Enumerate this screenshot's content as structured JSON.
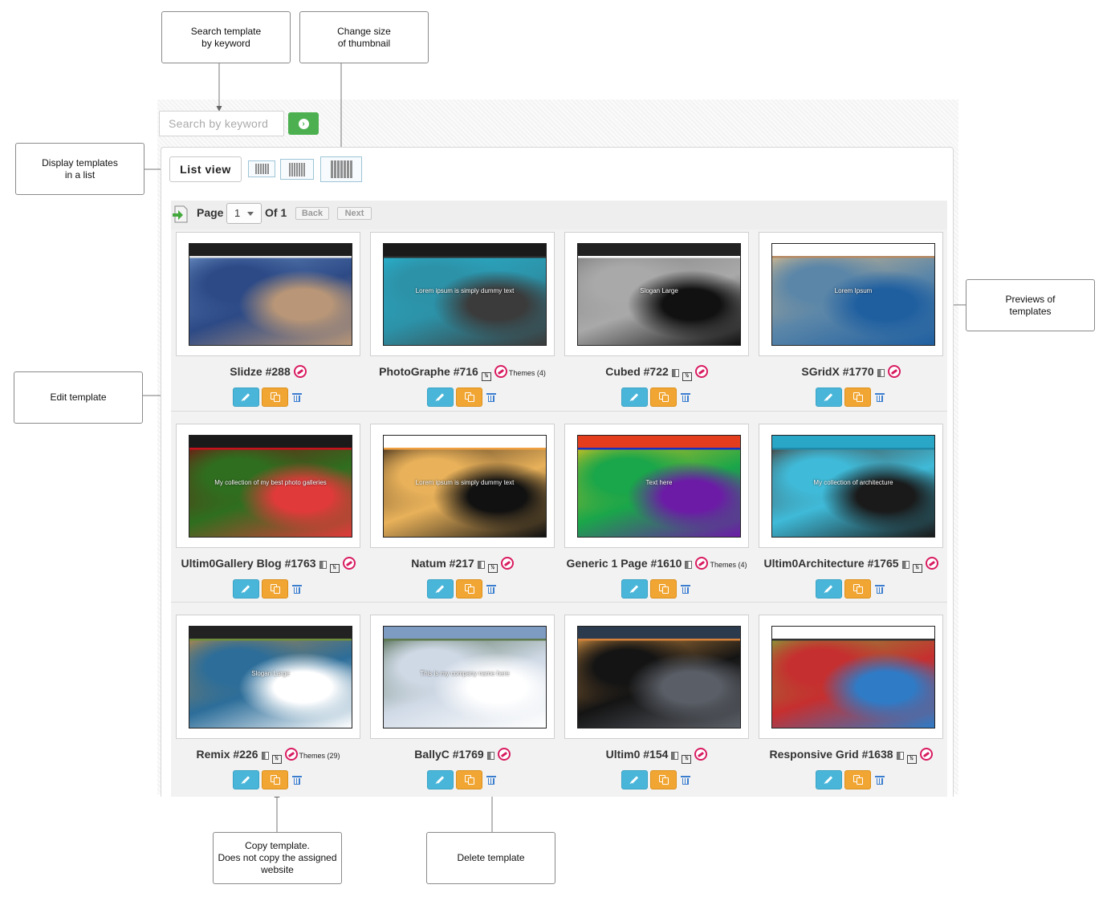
{
  "annotations": {
    "search": "Search template\nby keyword",
    "resize": "Change size\nof thumbnail",
    "list": "Display templates\nin a list",
    "previews": "Previews of\ntemplates",
    "edit": "Edit template",
    "copy": "Copy template.\nDoes not copy the assigned\nwebsite",
    "delete": "Delete template"
  },
  "search": {
    "placeholder": "Search by keyword"
  },
  "toolbar": {
    "list_view_label": "List view"
  },
  "pagination": {
    "page_label": "Page",
    "current_page": "1",
    "of_label": "Of 1",
    "back_label": "Back",
    "next_label": "Next"
  },
  "colors": {
    "edit": "#49b6d9",
    "copy": "#f1a532",
    "delete": "#3b7ed0",
    "go": "#4cb050",
    "badge": "#d81b60"
  },
  "templates": [
    {
      "name": "Slidze #288",
      "icons": [
        "theme-badge-icon"
      ],
      "themes": ""
    },
    {
      "name": "PhotoGraphe #716",
      "icons": [
        "half-size-icon",
        "theme-badge-icon"
      ],
      "themes": "Themes (4)"
    },
    {
      "name": "Cubed #722",
      "icons": [
        "layout-icon",
        "half-size-icon",
        "theme-badge-icon"
      ],
      "themes": ""
    },
    {
      "name": "SGridX #1770",
      "icons": [
        "layout-icon",
        "theme-badge-icon"
      ],
      "themes": ""
    },
    {
      "name": "Ultim0Gallery Blog #1763",
      "icons": [
        "layout-icon",
        "half-size-icon",
        "theme-badge-icon"
      ],
      "themes": ""
    },
    {
      "name": "Natum #217",
      "icons": [
        "layout-icon",
        "half-size-icon",
        "theme-badge-icon"
      ],
      "themes": ""
    },
    {
      "name": "Generic 1 Page #1610",
      "icons": [
        "layout-icon",
        "theme-badge-icon"
      ],
      "themes": "Themes (4)"
    },
    {
      "name": "Ultim0Architecture #1765",
      "icons": [
        "layout-icon",
        "half-size-icon",
        "theme-badge-icon"
      ],
      "themes": ""
    },
    {
      "name": "Remix #226",
      "icons": [
        "layout-icon",
        "half-size-icon",
        "theme-badge-icon"
      ],
      "themes": "Themes (29)"
    },
    {
      "name": "BallyC #1769",
      "icons": [
        "layout-icon",
        "theme-badge-icon"
      ],
      "themes": ""
    },
    {
      "name": "Ultim0 #154",
      "icons": [
        "layout-icon",
        "half-size-icon",
        "theme-badge-icon"
      ],
      "themes": ""
    },
    {
      "name": "Responsive Grid #1638",
      "icons": [
        "layout-icon",
        "half-size-icon",
        "theme-badge-icon"
      ],
      "themes": ""
    }
  ],
  "previews": [
    {
      "caption": "",
      "colors": [
        "#1e1e1e",
        "#e7e7e7",
        "#6f95c9",
        "#2d4a86",
        "#b89677"
      ]
    },
    {
      "caption": "Lorem ipsum is simply dummy text",
      "colors": [
        "#1a1a1a",
        "#2a2a2a",
        "#28b7d5",
        "#2c92a8",
        "#3b3b3b"
      ]
    },
    {
      "caption": "Slogan Large",
      "colors": [
        "#222222",
        "#ffffff",
        "#7c7c7c",
        "#a9a9a9",
        "#111111"
      ]
    },
    {
      "caption": "Lorem Ipsum",
      "colors": [
        "#ffffff",
        "#b68a63",
        "#e6c28b",
        "#5b86a8",
        "#1f5fa0"
      ]
    },
    {
      "caption": "My collection of my best photo galleries",
      "colors": [
        "#1a1a1a",
        "#c5121c",
        "#7a0d12",
        "#2f6e1f",
        "#e03a3a"
      ]
    },
    {
      "caption": "Lorem ipsum is simply dummy text",
      "colors": [
        "#ffffff",
        "#f0a040",
        "#2a1d14",
        "#e8b15a",
        "#111111"
      ]
    },
    {
      "caption": "Text here",
      "colors": [
        "#e43d1e",
        "#1b2fbf",
        "#f0c419",
        "#1aa64a",
        "#6c1ba6"
      ]
    },
    {
      "caption": "My collection of architecture",
      "colors": [
        "#2aa7c7",
        "#1f8aa8",
        "#4a2b20",
        "#3fbad8",
        "#1a1a1a"
      ]
    },
    {
      "caption": "Slogan Large",
      "colors": [
        "#222222",
        "#6f8e3c",
        "#c78c3b",
        "#2c6d99",
        "#ffffff"
      ]
    },
    {
      "caption": "This is my company name here",
      "colors": [
        "#7e9bc1",
        "#5c7a4b",
        "#3f5b3a",
        "#cfd9e6",
        "#ffffff"
      ]
    },
    {
      "caption": "",
      "colors": [
        "#2c3a4e",
        "#d6823a",
        "#f0a348",
        "#141414",
        "#5a5e66"
      ]
    },
    {
      "caption": "",
      "colors": [
        "#ffffff",
        "#333333",
        "#7bb03a",
        "#c62f2f",
        "#2f7bc6"
      ]
    }
  ]
}
